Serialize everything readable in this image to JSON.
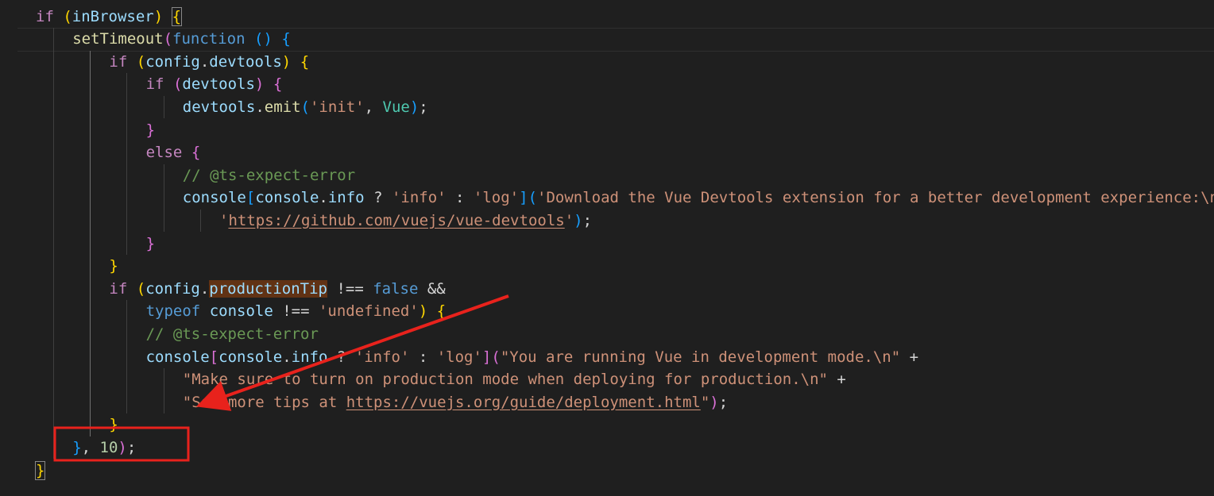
{
  "editor": {
    "theme_colors": {
      "background": "#1f1f1f",
      "keyword": "#569cd6",
      "control": "#c586c0",
      "variable": "#9cdcfe",
      "function": "#dcdcaa",
      "string": "#ce9178",
      "comment": "#6a9955",
      "number": "#b5cea8",
      "annotation": "#e8221c"
    },
    "lines": [
      {
        "indent": 0,
        "tokens": [
          {
            "t": "if",
            "c": "ctl"
          },
          {
            "t": " ",
            "c": "op"
          },
          {
            "t": "(",
            "c": "b1"
          },
          {
            "t": "inBrowser",
            "c": "var"
          },
          {
            "t": ")",
            "c": "b1"
          },
          {
            "t": " ",
            "c": "op"
          },
          {
            "t": "{",
            "c": "b1",
            "box": true
          }
        ]
      },
      {
        "indent": 1,
        "tokens": [
          {
            "t": "setTimeout",
            "c": "fn"
          },
          {
            "t": "(",
            "c": "b2"
          },
          {
            "t": "function",
            "c": "kw"
          },
          {
            "t": " ",
            "c": "op"
          },
          {
            "t": "()",
            "c": "b3"
          },
          {
            "t": " ",
            "c": "op"
          },
          {
            "t": "{",
            "c": "b3"
          }
        ]
      },
      {
        "indent": 2,
        "tokens": [
          {
            "t": "if",
            "c": "ctl"
          },
          {
            "t": " ",
            "c": "op"
          },
          {
            "t": "(",
            "c": "b1"
          },
          {
            "t": "config",
            "c": "var"
          },
          {
            "t": ".",
            "c": "op"
          },
          {
            "t": "devtools",
            "c": "var"
          },
          {
            "t": ")",
            "c": "b1"
          },
          {
            "t": " ",
            "c": "op"
          },
          {
            "t": "{",
            "c": "b1"
          }
        ]
      },
      {
        "indent": 3,
        "tokens": [
          {
            "t": "if",
            "c": "ctl"
          },
          {
            "t": " ",
            "c": "op"
          },
          {
            "t": "(",
            "c": "b2"
          },
          {
            "t": "devtools",
            "c": "var"
          },
          {
            "t": ")",
            "c": "b2"
          },
          {
            "t": " ",
            "c": "op"
          },
          {
            "t": "{",
            "c": "b2"
          }
        ]
      },
      {
        "indent": 4,
        "tokens": [
          {
            "t": "devtools",
            "c": "var"
          },
          {
            "t": ".",
            "c": "op"
          },
          {
            "t": "emit",
            "c": "fn"
          },
          {
            "t": "(",
            "c": "b3"
          },
          {
            "t": "'init'",
            "c": "str"
          },
          {
            "t": ", ",
            "c": "op"
          },
          {
            "t": "Vue",
            "c": "typ"
          },
          {
            "t": ")",
            "c": "b3"
          },
          {
            "t": ";",
            "c": "op"
          }
        ]
      },
      {
        "indent": 3,
        "tokens": [
          {
            "t": "}",
            "c": "b2"
          }
        ]
      },
      {
        "indent": 3,
        "tokens": [
          {
            "t": "else",
            "c": "ctl"
          },
          {
            "t": " ",
            "c": "op"
          },
          {
            "t": "{",
            "c": "b2"
          }
        ]
      },
      {
        "indent": 4,
        "tokens": [
          {
            "t": "// @ts-expect-error",
            "c": "cmt"
          }
        ]
      },
      {
        "indent": 4,
        "tokens": [
          {
            "t": "console",
            "c": "var"
          },
          {
            "t": "[",
            "c": "b3"
          },
          {
            "t": "console",
            "c": "var"
          },
          {
            "t": ".",
            "c": "op"
          },
          {
            "t": "info",
            "c": "var"
          },
          {
            "t": " ? ",
            "c": "op"
          },
          {
            "t": "'info'",
            "c": "str"
          },
          {
            "t": " : ",
            "c": "op"
          },
          {
            "t": "'log'",
            "c": "str"
          },
          {
            "t": "]",
            "c": "b3"
          },
          {
            "t": "(",
            "c": "b3"
          },
          {
            "t": "'Download the Vue Devtools extension for a better development experience:\\n'",
            "c": "str"
          }
        ]
      },
      {
        "indent": 5,
        "tokens": [
          {
            "t": "'",
            "c": "str"
          },
          {
            "t": "https://github.com/vuejs/vue-devtools",
            "c": "str",
            "link": true
          },
          {
            "t": "'",
            "c": "str"
          },
          {
            "t": ")",
            "c": "b3"
          },
          {
            "t": ";",
            "c": "op"
          }
        ]
      },
      {
        "indent": 3,
        "tokens": [
          {
            "t": "}",
            "c": "b2"
          }
        ]
      },
      {
        "indent": 2,
        "tokens": [
          {
            "t": "}",
            "c": "b1"
          }
        ]
      },
      {
        "indent": 2,
        "tokens": [
          {
            "t": "if",
            "c": "ctl"
          },
          {
            "t": " ",
            "c": "op"
          },
          {
            "t": "(",
            "c": "b1"
          },
          {
            "t": "config",
            "c": "var"
          },
          {
            "t": ".",
            "c": "op"
          },
          {
            "t": "productionTip",
            "c": "var",
            "hl": true
          },
          {
            "t": " !== ",
            "c": "op"
          },
          {
            "t": "false",
            "c": "kw"
          },
          {
            "t": " &&",
            "c": "op"
          }
        ]
      },
      {
        "indent": 3,
        "tokens": [
          {
            "t": "typeof",
            "c": "kw"
          },
          {
            "t": " ",
            "c": "op"
          },
          {
            "t": "console",
            "c": "var"
          },
          {
            "t": " !== ",
            "c": "op"
          },
          {
            "t": "'undefined'",
            "c": "str"
          },
          {
            "t": ")",
            "c": "b1"
          },
          {
            "t": " ",
            "c": "op"
          },
          {
            "t": "{",
            "c": "b1"
          }
        ]
      },
      {
        "indent": 3,
        "tokens": [
          {
            "t": "// @ts-expect-error",
            "c": "cmt"
          }
        ]
      },
      {
        "indent": 3,
        "tokens": [
          {
            "t": "console",
            "c": "var"
          },
          {
            "t": "[",
            "c": "b2"
          },
          {
            "t": "console",
            "c": "var"
          },
          {
            "t": ".",
            "c": "op"
          },
          {
            "t": "info",
            "c": "var"
          },
          {
            "t": " ? ",
            "c": "op"
          },
          {
            "t": "'info'",
            "c": "str"
          },
          {
            "t": " : ",
            "c": "op"
          },
          {
            "t": "'log'",
            "c": "str"
          },
          {
            "t": "]",
            "c": "b2"
          },
          {
            "t": "(",
            "c": "b2"
          },
          {
            "t": "\"You are running Vue in development mode.\\n\"",
            "c": "str"
          },
          {
            "t": " +",
            "c": "op"
          }
        ]
      },
      {
        "indent": 4,
        "tokens": [
          {
            "t": "\"Make sure to turn on production mode when deploying for production.\\n\"",
            "c": "str"
          },
          {
            "t": " +",
            "c": "op"
          }
        ]
      },
      {
        "indent": 4,
        "tokens": [
          {
            "t": "\"See more tips at ",
            "c": "str"
          },
          {
            "t": "https://vuejs.org/guide/deployment.html",
            "c": "str",
            "link": true
          },
          {
            "t": "\"",
            "c": "str"
          },
          {
            "t": ")",
            "c": "b2"
          },
          {
            "t": ";",
            "c": "op"
          }
        ]
      },
      {
        "indent": 2,
        "tokens": [
          {
            "t": "}",
            "c": "b1"
          }
        ]
      },
      {
        "indent": 1,
        "tokens": [
          {
            "t": "}",
            "c": "b3"
          },
          {
            "t": ", ",
            "c": "op"
          },
          {
            "t": "10",
            "c": "num"
          },
          {
            "t": ")",
            "c": "b2"
          },
          {
            "t": ";",
            "c": "op"
          }
        ]
      },
      {
        "indent": 0,
        "tokens": [
          {
            "t": "}",
            "c": "b1",
            "box": true
          }
        ]
      }
    ]
  }
}
